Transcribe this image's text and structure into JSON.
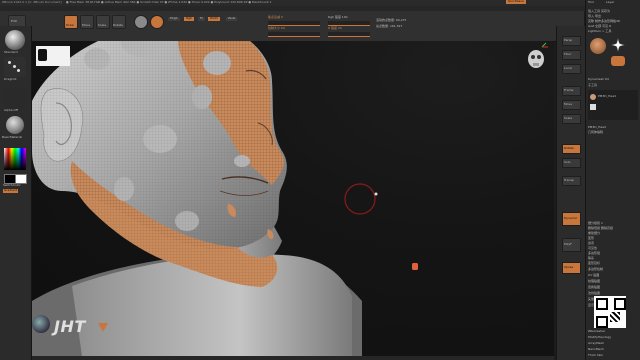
{
  "title_bar": {
    "app_title": "ZBrush 2022.0.1 [C: ZBrush Document]",
    "stats": "● Free Mem 38.617GB ● Active Mem 902.364 ● Scratch Disk 47 ● ZTime 1.032 ● Timer 0.022 ● PolyCount 120.896 KP ● MeshCount 1",
    "quicksave": "QuickSave"
  },
  "toolbar": {
    "edit_label": "Edit",
    "draw_label": "Draw",
    "move_label": "Move",
    "scale_label": "Scale",
    "rotate_label": "Rotate",
    "mrgb": "Mrgb",
    "rgb": "Rgb",
    "m": "M",
    "zadd": "Zadd",
    "zsub": "Zsub",
    "focal_shift": "焦点衰减 0",
    "draw_size": "绘制大小 64",
    "rgb_intensity": "Rgb 强度 100",
    "z_intensity": "Z 强度 25",
    "active_points": "活动的点数量: 60,237",
    "total_points": "总点数量: 161,397",
    "dynamic": "Dynamic"
  },
  "left_shelf": {
    "brush_name": "Standard",
    "stroke_name": "DragDot",
    "alpha_name": "Alpha Off",
    "material_name": "BasicMaterial",
    "texture_name": "Texture Off",
    "switch_color": "SwitchColor",
    "gradient": "Gradient"
  },
  "right_shelf": {
    "buttons": [
      "Persp",
      "Floor",
      "Local",
      "Frame",
      "Move",
      "Scale",
      "Rotate",
      "Solo",
      "Transp",
      "Dynamic",
      "PolyF",
      "Xpose"
    ]
  },
  "right_panel": {
    "header_tabs": [
      "Tool",
      "Layer"
    ],
    "rows": [
      "载入工具 另存为",
      "导入 导出",
      "克隆 制作多边形网格3D",
      "GoZ 全部 可见 R",
      "Lightbox > 工具",
      "Dynamesh 64",
      "子工具",
      "PM3D_Head",
      "几何体编辑",
      "细分级别 1",
      "删除低级 删除高级",
      "重建细分",
      "变形",
      "遮罩",
      "可见性",
      "多边形组",
      "联系",
      "变形目标",
      "多边形绘制",
      "UV 贴图",
      "纹理贴图",
      "置换贴图",
      "法线贴图",
      "矢量置换贴图",
      "显示属性",
      "统一蒙皮",
      "初始化",
      "导入",
      "导出"
    ],
    "subtool_name": "PM3D_Head",
    "layer_labels": [
      "ZRemesher",
      "ModifyTopology",
      "ArrayMesh",
      "NanoMesh",
      "Thick Skin"
    ]
  },
  "viewport": {
    "watermark": "JHT"
  },
  "colors": {
    "accent": "#c8763b",
    "mask_orange": "#c98a5c",
    "skin_gray": "#b8b8b8"
  }
}
